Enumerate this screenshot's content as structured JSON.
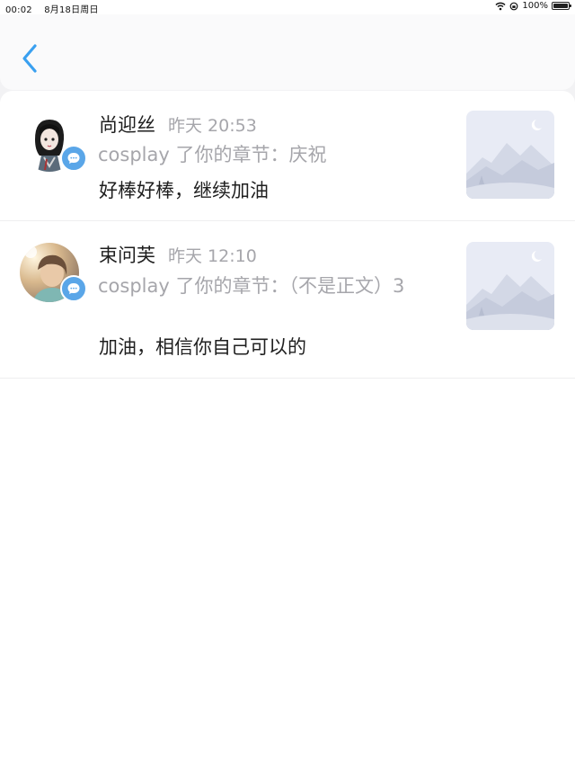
{
  "status_bar": {
    "time": "00:02",
    "date": "8月18日周日",
    "battery": "100%",
    "battery_level": 1.0,
    "icons": [
      "wifi-icon",
      "orientation-lock-icon",
      "battery-icon"
    ]
  },
  "header": {
    "back_icon": "chevron-left-icon",
    "accent": "#3aa0f0"
  },
  "notifications": [
    {
      "name": "尚迎丝",
      "time": "昨天 20:53",
      "action": "cosplay 了你的章节：庆祝",
      "comment": "好棒好棒，继续加油",
      "badge_icon": "chat-bubble-icon",
      "thumbnail_icon": "mountain-placeholder-icon"
    },
    {
      "name": "束问芙",
      "time": "昨天 12:10",
      "action": "cosplay 了你的章节：（不是正文）3",
      "comment": "加油，相信你自己可以的",
      "badge_icon": "chat-bubble-icon",
      "thumbnail_icon": "mountain-placeholder-icon"
    }
  ],
  "colors": {
    "badge": "#5aa6e8",
    "secondary_text": "#a6a6ab",
    "thumbnail_bg": "#e8ebf5"
  }
}
